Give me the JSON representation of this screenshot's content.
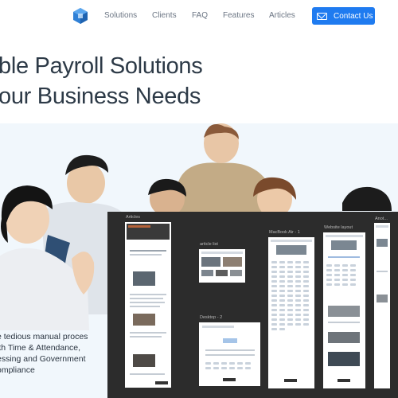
{
  "nav": {
    "links": [
      "Solutions",
      "Clients",
      "FAQ",
      "Features",
      "Articles"
    ],
    "contact_label": "Contact Us"
  },
  "hero": {
    "title_line1": "ble Payroll Solutions",
    "title_line2": "our Business Needs",
    "desc_line1": "e tedious manual proces",
    "desc_line2": "ith Time & Attendance,",
    "desc_line3": "essing and Government",
    "desc_line4": "ompliance"
  },
  "figma": {
    "frames": [
      "Articles",
      "article list",
      "Desktop - 2",
      "MacBook Air - 1",
      "Website layout",
      "Anot..."
    ]
  },
  "colors": {
    "accent": "#1f7bf0",
    "title": "#2d3a47",
    "figma_bg": "#2c2c2c"
  }
}
